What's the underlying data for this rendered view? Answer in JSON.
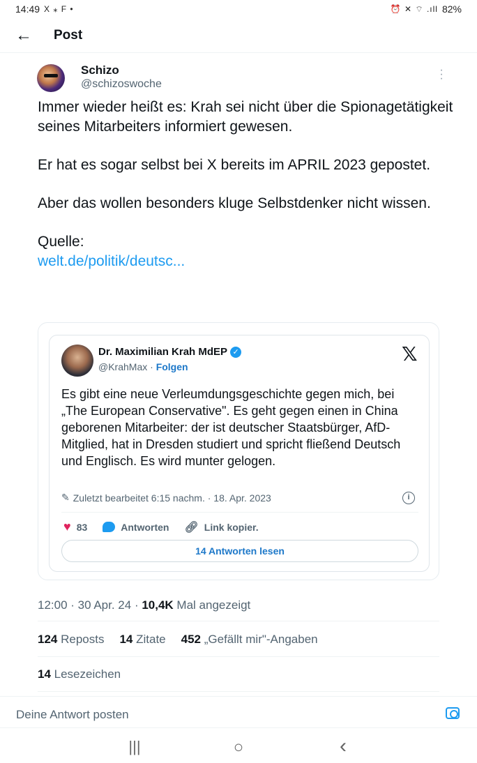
{
  "status_bar": {
    "time": "14:49",
    "left_icons": "X ⁎ F •",
    "right_icons": "⏰ ✕ ⌔ .ıll",
    "battery": "82%"
  },
  "header": {
    "title": "Post"
  },
  "post": {
    "author_name": "Schizo",
    "author_handle": "@schizoswoche",
    "paragraphs": [
      "Immer wieder heißt es: Krah sei nicht über die Spionagetätigkeit seines Mitarbeiters informiert gewesen.",
      "Er hat es sogar selbst bei X bereits im APRIL 2023 gepostet.",
      "Aber das wollen besonders kluge Selbstdenker nicht wissen."
    ],
    "source_label": "Quelle:",
    "source_link": "welt.de/politik/deutsc..."
  },
  "embed": {
    "name": "Dr. Maximilian Krah MdEP",
    "handle": "@KrahMax",
    "separator": " · ",
    "follow": "Folgen",
    "x_logo": "𝕏",
    "text": "Es gibt eine neue Verleumdungsgeschichte gegen mich, bei „The European Conservative\". Es geht gegen einen in China geborenen Mitarbeiter: der ist deutscher Staatsbürger, AfD-Mitglied, hat in Dresden studiert und spricht fließend Deutsch und Englisch. Es wird munter gelogen.",
    "edited": "Zuletzt bearbeitet 6:15 nachm. · 18. Apr. 2023",
    "likes": "83",
    "reply_label": "Antworten",
    "link_label": "Link kopier.",
    "read_replies": "14 Antworten lesen"
  },
  "meta": {
    "time": "12:00 · 30 Apr. 24 · ",
    "views": "10,4K",
    "views_label": " Mal angezeigt"
  },
  "stats": {
    "reposts": "124",
    "reposts_label": " Reposts",
    "quotes": "14",
    "quotes_label": " Zitate",
    "likes": "452",
    "likes_label": " „Gefällt mir\"-Angaben",
    "bookmarks": "14",
    "bookmarks_label": " Lesezeichen"
  },
  "reply": {
    "placeholder": "Deine Antwort posten"
  },
  "navbar": {
    "recents": "|||",
    "home": "○",
    "back": "‹"
  }
}
